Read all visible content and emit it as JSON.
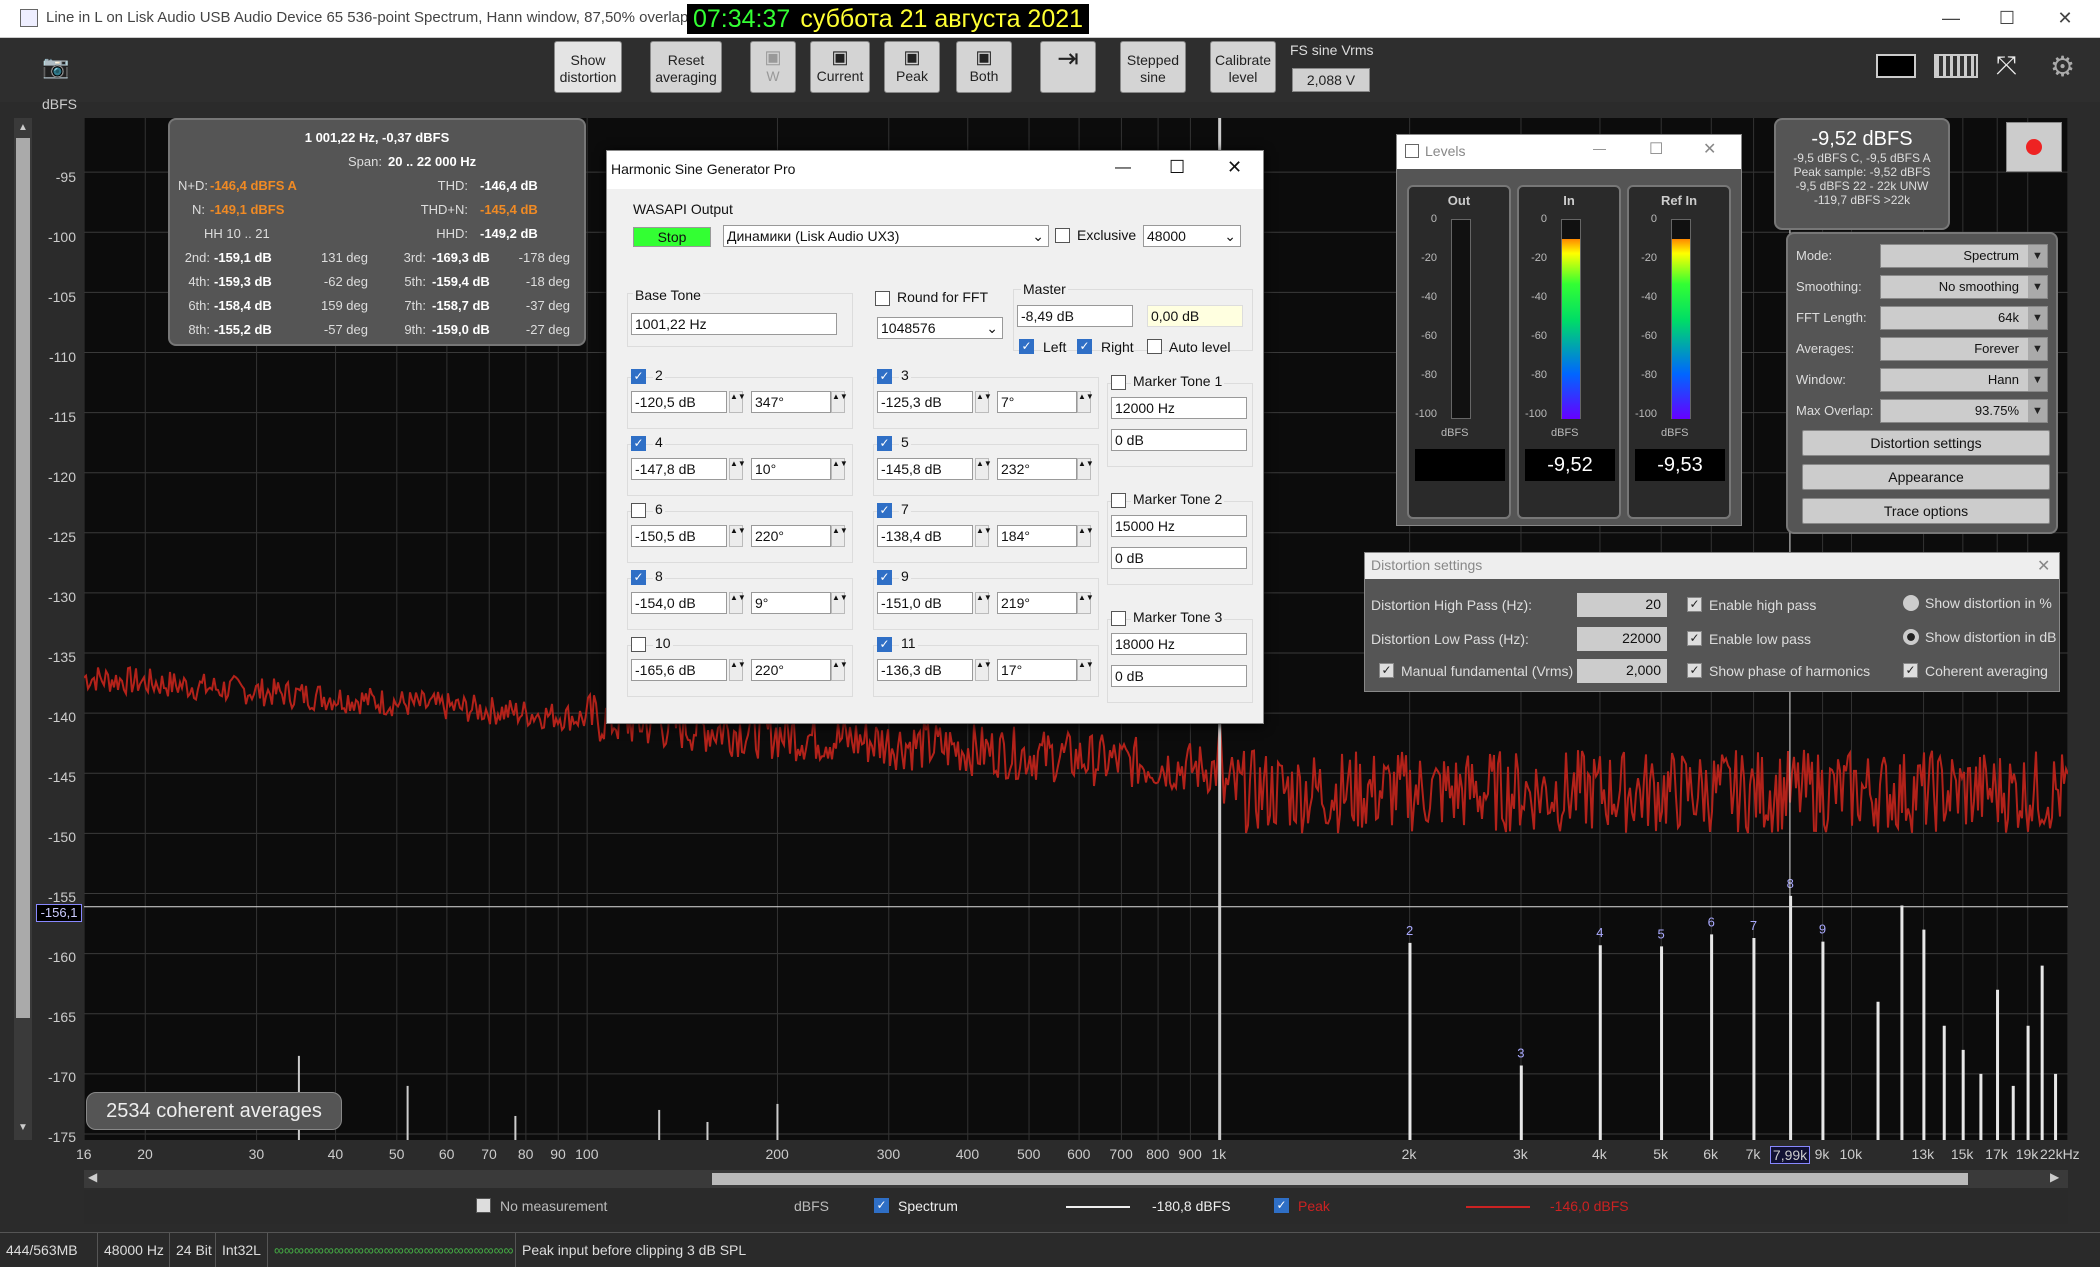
{
  "window": {
    "title": "Line in L on Lisk Audio USB Audio Device 65 536-point Spectrum, Hann window, 87,50% overlap,",
    "clock_time": "07:34:37",
    "clock_date": "суббота 21 августа 2021",
    "min": "—",
    "max": "☐",
    "close": "✕"
  },
  "toolbar": {
    "show_distortion": "Show distortion",
    "reset_averaging": "Reset averaging",
    "w": "W",
    "current": "Current",
    "peak": "Peak",
    "both": "Both",
    "stepped_sine": "Stepped sine",
    "calibrate_level": "Calibrate level",
    "fs_label": "FS sine Vrms",
    "fs_value": "2,088 V",
    "y_unit": "dBFS"
  },
  "y_ticks": [
    "-95",
    "-100",
    "-105",
    "-110",
    "-115",
    "-120",
    "-125",
    "-130",
    "-135",
    "-140",
    "-145",
    "-150",
    "-155",
    "-160",
    "-165",
    "-170",
    "-175"
  ],
  "x_ticks": [
    "16",
    "20",
    "30",
    "40",
    "50",
    "60",
    "70",
    "80",
    "90",
    "100",
    "200",
    "300",
    "400",
    "500",
    "600",
    "700",
    "800",
    "900",
    "1k",
    "2k",
    "3k",
    "4k",
    "5k",
    "6k",
    "7k",
    "7,99k",
    "9k",
    "10k",
    "13k",
    "15k",
    "17k",
    "19k",
    "22kHz"
  ],
  "cursor_level": "-156,1",
  "harmonic_labels": [
    "2",
    "3",
    "4",
    "5",
    "6",
    "7",
    "8",
    "9"
  ],
  "averages_badge": "2534 coherent averages",
  "info": {
    "header": "1 001,22 Hz, -0,37 dBFS",
    "span_label": "Span:",
    "span_value": "20 .. 22 000 Hz",
    "nd_label": "N+D:",
    "nd_value": "-146,4 dBFS A",
    "thd_label": "THD:",
    "thd_value": "-146,4 dB",
    "n_label": "N:",
    "n_value": "-149,1 dBFS",
    "thdn_label": "THD+N:",
    "thdn_value": "-145,4 dB",
    "hh_label": "HH 10 .. 21",
    "hhd_label": "HHD:",
    "hhd_value": "-149,2 dB",
    "rows": [
      [
        "2nd:",
        "-159,1 dB",
        "131 deg",
        "3rd:",
        "-169,3 dB",
        "-178 deg"
      ],
      [
        "4th:",
        "-159,3 dB",
        "-62 deg",
        "5th:",
        "-159,4 dB",
        "-18 deg"
      ],
      [
        "6th:",
        "-158,4 dB",
        "159 deg",
        "7th:",
        "-158,7 dB",
        "-37 deg"
      ],
      [
        "8th:",
        "-155,2 dB",
        "-57 deg",
        "9th:",
        "-159,0 dB",
        "-27 deg"
      ]
    ]
  },
  "generator": {
    "title": "Harmonic Sine Generator Pro",
    "output_label": "WASAPI Output",
    "stop": "Stop",
    "device": "Динамики (Lisk Audio UX3)",
    "exclusive": "Exclusive",
    "rate": "48000",
    "base_tone_label": "Base Tone",
    "base_tone": "1001,22 Hz",
    "round_fft": "Round for FFT",
    "fft_size": "1048576",
    "master_label": "Master",
    "master_db": "-8,49 dB",
    "master_gain": "0,00 dB",
    "left": "Left",
    "right": "Right",
    "auto_level": "Auto level",
    "harmonics": [
      {
        "n": "2",
        "on": true,
        "db": "-120,5 dB",
        "ph": "347°"
      },
      {
        "n": "3",
        "on": true,
        "db": "-125,3 dB",
        "ph": "7°"
      },
      {
        "n": "4",
        "on": true,
        "db": "-147,8 dB",
        "ph": "10°"
      },
      {
        "n": "5",
        "on": true,
        "db": "-145,8 dB",
        "ph": "232°"
      },
      {
        "n": "6",
        "on": false,
        "db": "-150,5 dB",
        "ph": "220°"
      },
      {
        "n": "7",
        "on": true,
        "db": "-138,4 dB",
        "ph": "184°"
      },
      {
        "n": "8",
        "on": true,
        "db": "-154,0 dB",
        "ph": "9°"
      },
      {
        "n": "9",
        "on": true,
        "db": "-151,0 dB",
        "ph": "219°"
      },
      {
        "n": "10",
        "on": false,
        "db": "-165,6 dB",
        "ph": "220°"
      },
      {
        "n": "11",
        "on": true,
        "db": "-136,3 dB",
        "ph": "17°"
      }
    ],
    "markers": [
      {
        "label": "Marker Tone 1",
        "hz": "12000 Hz",
        "db": "0 dB"
      },
      {
        "label": "Marker Tone 2",
        "hz": "15000 Hz",
        "db": "0 dB"
      },
      {
        "label": "Marker Tone 3",
        "hz": "18000 Hz",
        "db": "0 dB"
      }
    ]
  },
  "levels": {
    "title": "Levels",
    "out": "Out",
    "in": "In",
    "ref_in": "Ref In",
    "unit": "dBFS",
    "in_value": "-9,52",
    "ref_value": "-9,53",
    "scale": [
      "0",
      "-20",
      "-40",
      "-60",
      "-80",
      "-100"
    ],
    "in_fill": 0.9,
    "ref_fill": 0.9
  },
  "readout": {
    "big": "-9,52 dBFS",
    "l1": "-9,5 dBFS C, -9,5 dBFS A",
    "l2": "Peak sample: -9,52 dBFS",
    "l3": "-9,5 dBFS 22 - 22k UNW",
    "l4": "-119,7 dBFS >22k"
  },
  "settings": {
    "mode_label": "Mode:",
    "mode": "Spectrum",
    "smoothing_label": "Smoothing:",
    "smoothing": "No  smoothing",
    "fft_label": "FFT Length:",
    "fft": "64k",
    "avg_label": "Averages:",
    "avg": "Forever",
    "window_label": "Window:",
    "window": "Hann",
    "overlap_label": "Max Overlap:",
    "overlap": "93.75%",
    "dist_btn": "Distortion settings",
    "appearance_btn": "Appearance",
    "trace_btn": "Trace options"
  },
  "distortion": {
    "title": "Distortion settings",
    "hp_label": "Distortion High Pass (Hz):",
    "hp": "20",
    "lp_label": "Distortion Low Pass (Hz):",
    "lp": "22000",
    "manual_label": "Manual fundamental (Vrms)",
    "manual": "2,000",
    "enable_hp": "Enable high pass",
    "enable_lp": "Enable low pass",
    "show_phase": "Show phase of harmonics",
    "show_pct": "Show distortion in %",
    "show_db": "Show distortion in dB",
    "coherent": "Coherent averaging"
  },
  "legend": {
    "no_meas": "No measurement",
    "unit": "dBFS",
    "spectrum": "Spectrum",
    "spectrum_val": "-180,8 dBFS",
    "peak": "Peak",
    "peak_val": "-146,0 dBFS"
  },
  "status": {
    "mem": "444/563MB",
    "rate": "48000 Hz",
    "bits": "24 Bit",
    "fmt": "Int32L",
    "msg": "Peak input before clipping 3 dB SPL"
  },
  "colors": {
    "trace": "#b3221a",
    "harmonic": "#e8e8e8",
    "accent": "#f08a24"
  }
}
